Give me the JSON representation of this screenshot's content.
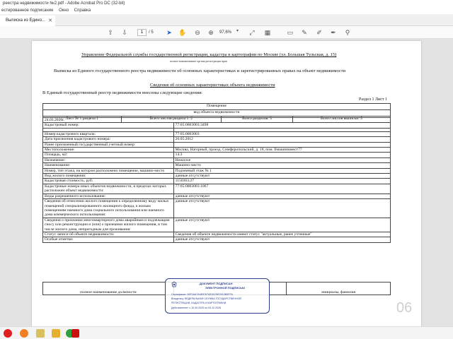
{
  "window": {
    "title": "реестра недвижимости №2.pdf - Adobe Acrobat Pro DC (32-bit)",
    "menu": [
      "естированное подписание",
      "Окно",
      "Справка"
    ],
    "tab": "Выписка из Едино..."
  },
  "toolbar": {
    "page_current": "1",
    "page_total": "/ 5",
    "zoom": "97,6%"
  },
  "document": {
    "header_line": "Управление Федеральной службы государственной регистрации, кадастра и картографии по Москве (ул. Большая Тульская, д. 15)",
    "header_sub": "полное наименование органа регистрации прав",
    "main_title": "Выписка из Единого государственного реестра недвижимости об основных характеристиках и зарегистрированных правах на объект недвижимости",
    "section_title": "Сведения об основных характеристиках объекта недвижимости",
    "intro": "В Единый государственный реестр недвижимости внесены следующие сведения:",
    "section_no": "Раздел 1 Лист 1",
    "head": {
      "type": "Помещение",
      "kind_label": "вид объекта недвижимости",
      "sheet": "Лист № 1 раздела 1",
      "total_sheets_section": "Всего листов раздела 1: 2",
      "total_sections": "Всего разделов: 3",
      "total_sheets_extract": "Всего листов выписки: 5"
    },
    "date": "24.03.2026г.",
    "rows": [
      {
        "label": "Кадастровый номер:",
        "value": "77:05:0003003:3498"
      },
      {
        "label": "",
        "value": ""
      },
      {
        "label": "Номер кадастрового квартала:",
        "value": "77:05:0003003"
      },
      {
        "label": "Дата присвоения кадастрового номера:",
        "value": "26.05.2012"
      },
      {
        "label": "Ранее присвоенный государственный учетный номер:",
        "value": ""
      },
      {
        "label": "Местоположение:",
        "value": "Москва, Нагорный, проезд. Симферопольский, д. 18, пом. Ilмашинимест77"
      },
      {
        "label": "Площадь, м2:",
        "value": "14.3"
      },
      {
        "label": "Назначение:",
        "value": "Нежилое"
      },
      {
        "label": "Наименование:",
        "value": "Машино-место"
      },
      {
        "label": "Номер, тип этажа, на котором расположено помещение, машино-место",
        "value": "Подземный этаж № 1"
      },
      {
        "label": "Вид жилого помещения:",
        "value": "данные отсутствуют"
      },
      {
        "label": "Кадастровая стоимость, руб:",
        "value": "1150363.27"
      },
      {
        "label": "Кадастровые номера иных объектов недвижимости, в пределах которых расположен объект недвижимости:",
        "value": "77:05:0003003:1067"
      },
      {
        "label": "Виды разрешенного использования:",
        "value": "данные отсутствуют"
      },
      {
        "label": "Сведения об отнесении жилого помещения к определенному виду жилых помещений специализированного жилищного фонда, к жилым помещениям наемного дома социального использования или наемного дома коммерческого использования:",
        "value": "данные отсутствуют"
      },
      {
        "label": "Сведения о признании многоквартирного дома аварийным и подлежащим сносу или реконструкции и (или) о признании жилого помещения, в том числе жилого дома, непригодным для проживания:",
        "value": "данные отсутствуют"
      },
      {
        "label": "Статус записи об объекте недвижимости:",
        "value": "Сведения об объекте недвижимости имеют статус \"актуальные, ранее учтенные\""
      },
      {
        "label": "Особые отметки:",
        "value": "данные отсутствуют"
      }
    ],
    "footer": {
      "left": "полное наименование должности",
      "right": "инициалы, фамилия"
    },
    "stamp": {
      "line1": "ДОКУМЕНТ ПОДПИСАН",
      "line2": "ЭЛЕКТРОННОЙ ПОДПИСЬЮ",
      "line3": "Сертификат: 00F2AA7A4E9767AE0C09E2012B5FFA",
      "line4": "Владелец: ФЕДЕРАЛЬНАЯ СЛУЖБА ГОСУДАРСТВЕННОЙ",
      "line5": "РЕГИСТРАЦИИ, КАДАСТРА И КАРТОГРАФИИ",
      "line6": "Действителен: с 10.09.2025 по 03.12.2026"
    },
    "watermark": "06"
  },
  "taskbar": {
    "icons": [
      "yandex-icon",
      "firefox-icon",
      "explorer-icon",
      "folder-icon",
      "chrome-icon",
      "acrobat-icon"
    ]
  }
}
